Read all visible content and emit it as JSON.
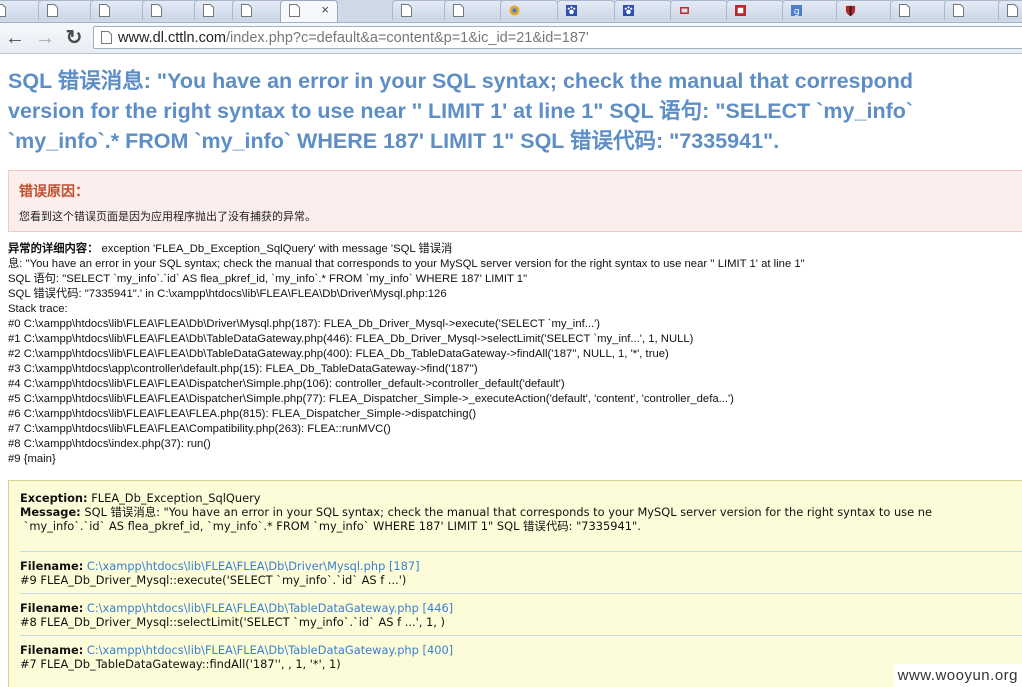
{
  "browser": {
    "tab_close": "×",
    "url_host": "www.dl.cttln.com",
    "url_path": "/index.php?c=default&a=content&p=1&ic_id=21&id=187'",
    "back": "←",
    "forward": "→",
    "reload": "↻"
  },
  "error": {
    "lines": [
      "SQL 错误消息: \"You have an error in your SQL syntax; check the manual that correspond",
      "version for the right syntax to use near '' LIMIT 1' at line 1\" SQL 语句: \"SELECT `my_info`",
      "`my_info`.* FROM `my_info` WHERE 187' LIMIT 1\" SQL 错误代码: \"7335941\"."
    ],
    "reason_title": "错误原因：",
    "reason_text": "您看到这个错误页面是因为应用程序抛出了没有捕获的异常。",
    "details_label": "异常的详细内容：",
    "details_lines": [
      " exception 'FLEA_Db_Exception_SqlQuery' with message 'SQL 错误消",
      "息: \"You have an error in your SQL syntax; check the manual that corresponds to your MySQL server version for the right syntax to use near '' LIMIT 1' at line 1\"",
      "SQL 语句: \"SELECT `my_info`.`id` AS flea_pkref_id, `my_info`.* FROM `my_info` WHERE 187' LIMIT 1\"",
      "SQL 错误代码: \"7335941\".' in C:\\xampp\\htdocs\\lib\\FLEA\\FLEA\\Db\\Driver\\Mysql.php:126",
      "Stack trace:",
      "#0 C:\\xampp\\htdocs\\lib\\FLEA\\FLEA\\Db\\Driver\\Mysql.php(187): FLEA_Db_Driver_Mysql->execute('SELECT `my_inf...')",
      "#1 C:\\xampp\\htdocs\\lib\\FLEA\\FLEA\\Db\\TableDataGateway.php(446): FLEA_Db_Driver_Mysql->selectLimit('SELECT `my_inf...', 1, NULL)",
      "#2 C:\\xampp\\htdocs\\lib\\FLEA\\FLEA\\Db\\TableDataGateway.php(400): FLEA_Db_TableDataGateway->findAll('187'', NULL, 1, '*', true)",
      "#3 C:\\xampp\\htdocs\\app\\controller\\default.php(15): FLEA_Db_TableDataGateway->find('187'')",
      "#4 C:\\xampp\\htdocs\\lib\\FLEA\\FLEA\\Dispatcher\\Simple.php(106): controller_default->controller_default('default')",
      "#5 C:\\xampp\\htdocs\\lib\\FLEA\\FLEA\\Dispatcher\\Simple.php(77): FLEA_Dispatcher_Simple->_executeAction('default', 'content', 'controller_defa...')",
      "#6 C:\\xampp\\htdocs\\lib\\FLEA\\FLEA\\FLEA.php(815): FLEA_Dispatcher_Simple->dispatching()",
      "#7 C:\\xampp\\htdocs\\lib\\FLEA\\FLEA\\Compatibility.php(263): FLEA::runMVC()",
      "#8 C:\\xampp\\htdocs\\index.php(37): run()",
      "#9 {main}"
    ],
    "exception_label": "Exception:",
    "exception_value": " FLEA_Db_Exception_SqlQuery",
    "message_label": "Message:",
    "message_value": " SQL 错误消息: \"You have an error in your SQL syntax; check the manual that corresponds to your MySQL server version for the right syntax to use ne",
    "message_value2": " `my_info`.`id` AS flea_pkref_id, `my_info`.* FROM `my_info` WHERE 187' LIMIT 1\" SQL 错误代码: \"7335941\".",
    "filename_label": "Filename:",
    "frames": [
      {
        "path": " C:\\xampp\\htdocs\\lib\\FLEA\\FLEA\\Db\\Driver\\Mysql.php [187]",
        "call": "#9 FLEA_Db_Driver_Mysql::execute('SELECT `my_info`.`id` AS f ...')"
      },
      {
        "path": " C:\\xampp\\htdocs\\lib\\FLEA\\FLEA\\Db\\TableDataGateway.php [446]",
        "call": "#8 FLEA_Db_Driver_Mysql::selectLimit('SELECT `my_info`.`id` AS f ...', 1, )"
      },
      {
        "path": " C:\\xampp\\htdocs\\lib\\FLEA\\FLEA\\Db\\TableDataGateway.php [400]",
        "call": "#7 FLEA_Db_TableDataGateway::findAll('187'', , 1, '*', 1)"
      }
    ]
  },
  "watermark": "www.wooyun.org"
}
